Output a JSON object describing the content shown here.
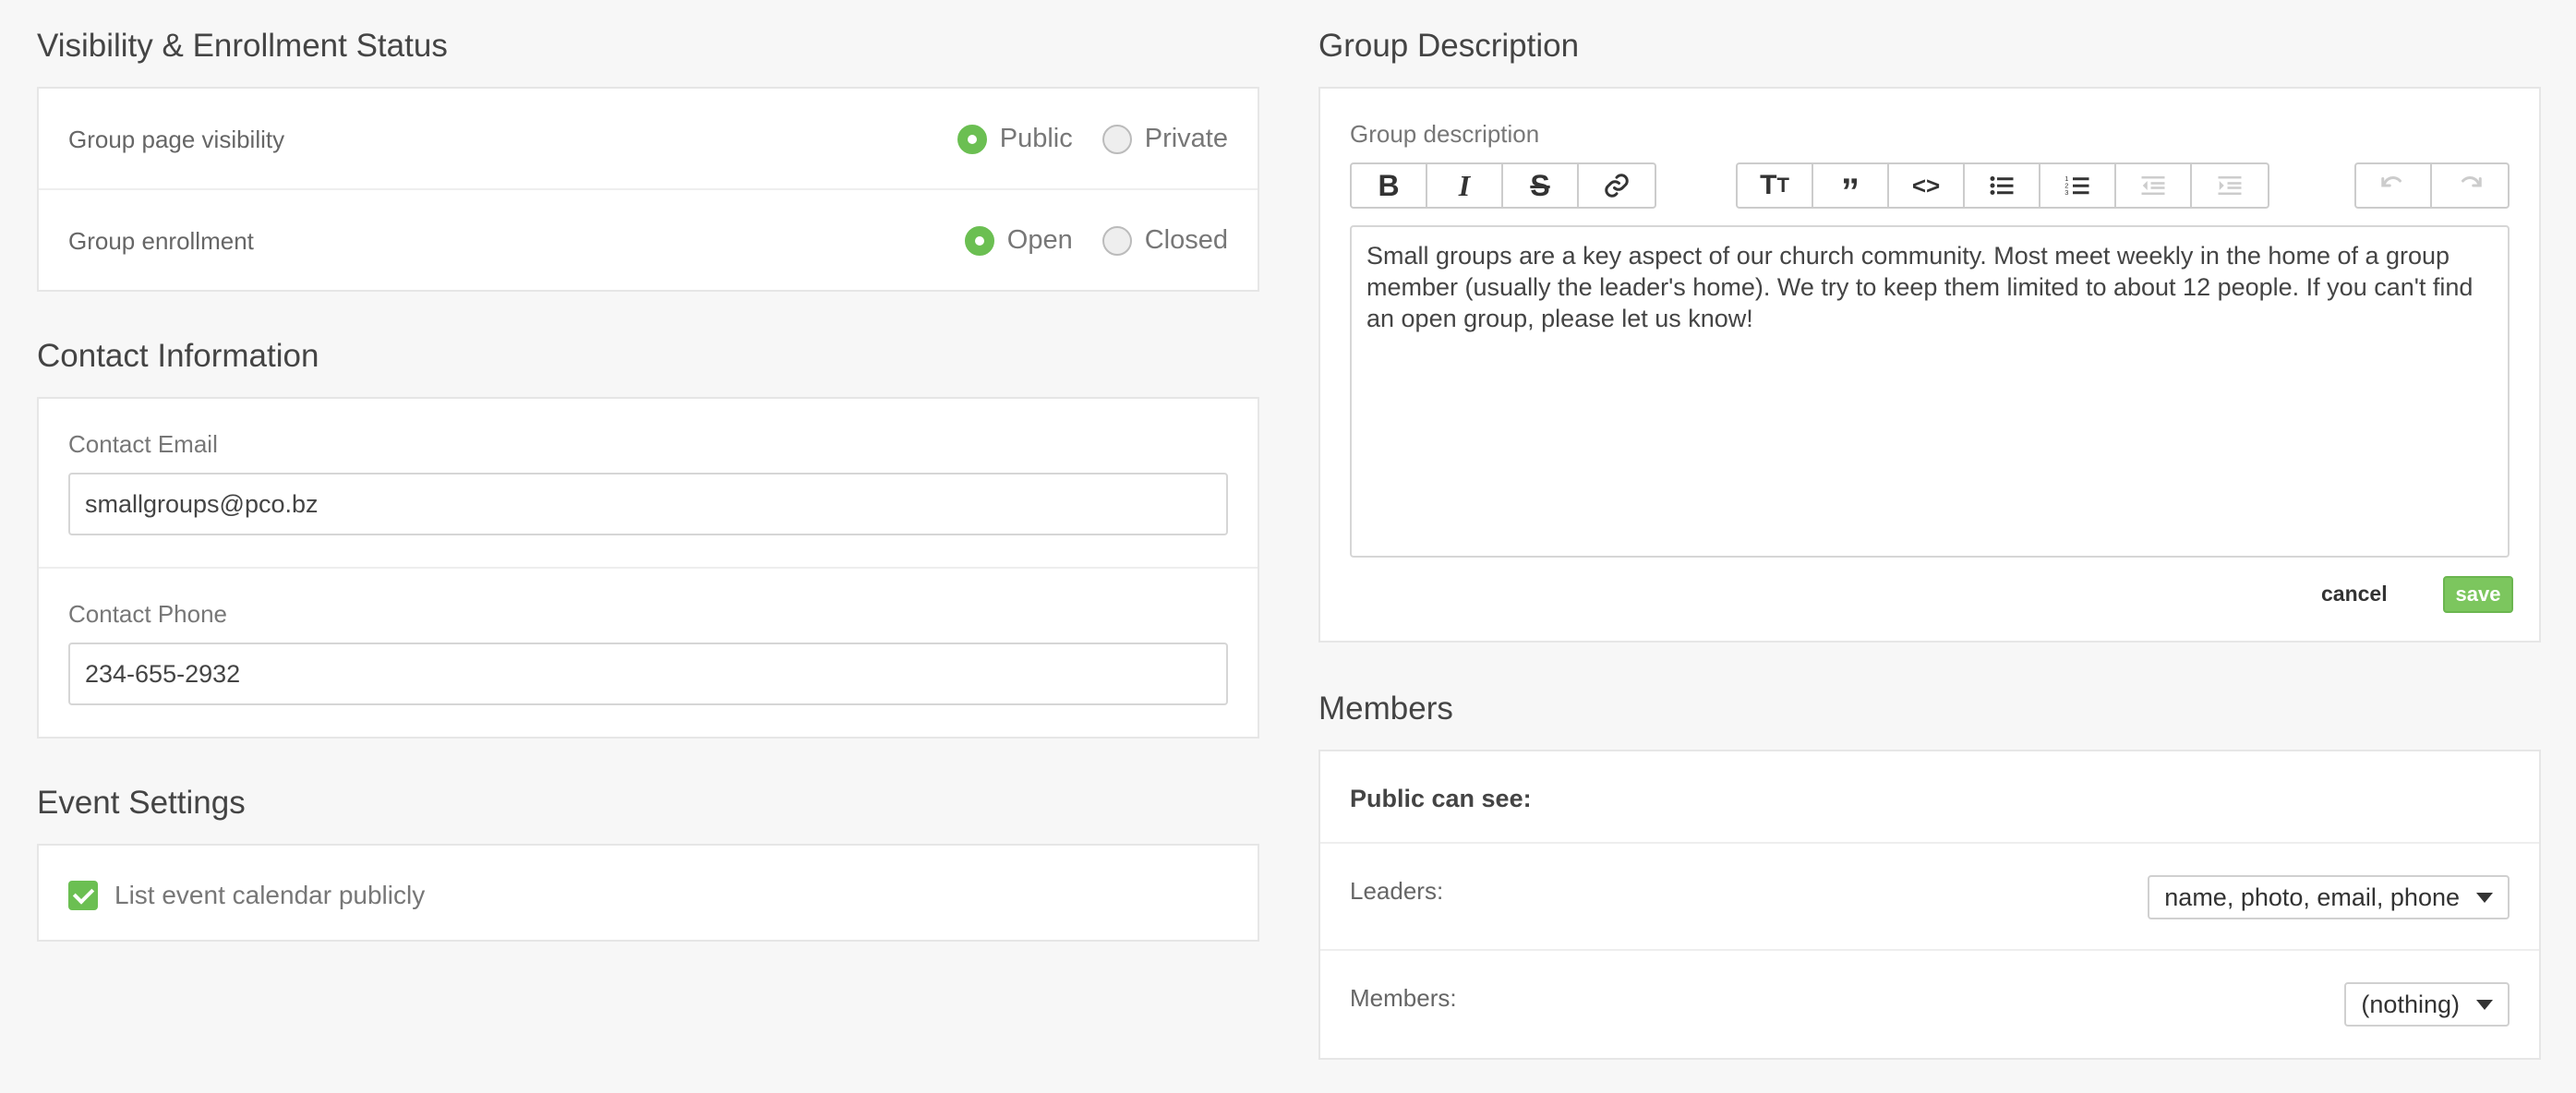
{
  "visibility": {
    "title": "Visibility & Enrollment Status",
    "page_visibility": {
      "label": "Group page visibility",
      "options": [
        "Public",
        "Private"
      ],
      "selected": "Public"
    },
    "enrollment": {
      "label": "Group enrollment",
      "options": [
        "Open",
        "Closed"
      ],
      "selected": "Open"
    }
  },
  "contact": {
    "title": "Contact Information",
    "email_label": "Contact Email",
    "email_value": "smallgroups@pco.bz",
    "phone_label": "Contact Phone",
    "phone_value": "234-655-2932"
  },
  "events": {
    "title": "Event Settings",
    "list_calendar_label": "List event calendar publicly",
    "list_calendar_checked": true
  },
  "description": {
    "title": "Group Description",
    "field_label": "Group description",
    "text": "Small groups are a key aspect of our church community. Most meet weekly in the home of a group member (usually the leader's home). We try to keep them limited to about 12 people. If you can't find an open group, please let us know!",
    "cancel_label": "cancel",
    "save_label": "save",
    "toolbar": {
      "format_icons": [
        "bold-icon",
        "italic-icon",
        "strikethrough-icon",
        "link-icon"
      ],
      "block_icons": [
        "heading-icon",
        "quote-icon",
        "code-icon",
        "bullet-list-icon",
        "numbered-list-icon",
        "outdent-icon",
        "indent-icon"
      ],
      "history_icons": [
        "undo-icon",
        "redo-icon"
      ]
    }
  },
  "members": {
    "title": "Members",
    "public_can_see": "Public can see:",
    "leaders_label": "Leaders:",
    "leaders_value": "name, photo, email, phone",
    "members_label": "Members:",
    "members_value": "(nothing)"
  },
  "colors": {
    "accent": "#6bbf52",
    "save": "#7cc65e",
    "background": "#f7f7f7"
  }
}
